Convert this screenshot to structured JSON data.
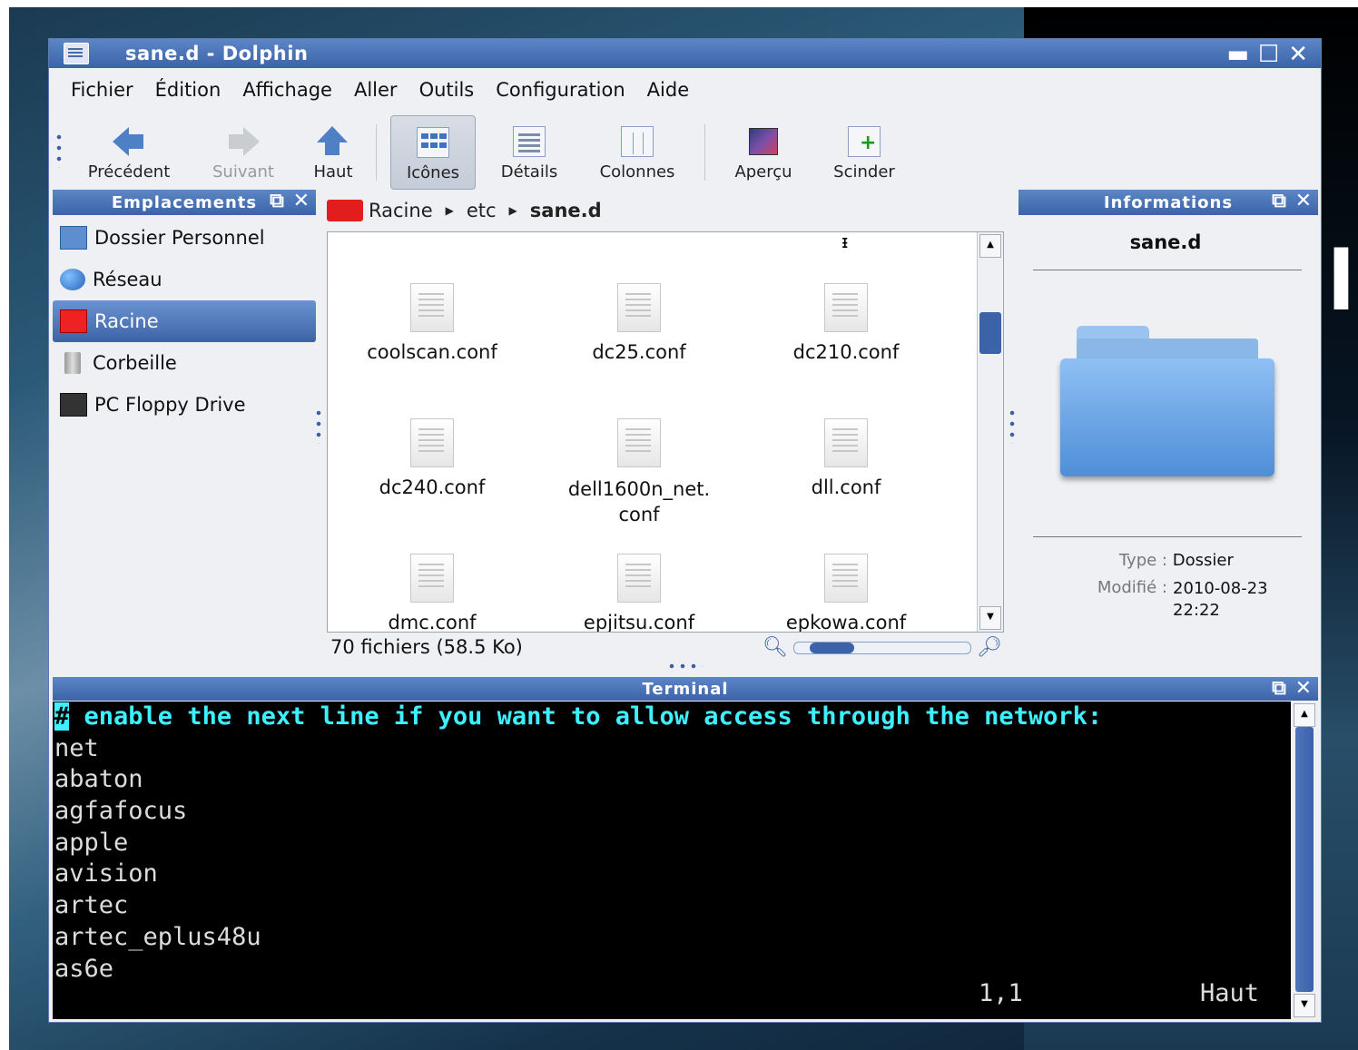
{
  "window": {
    "title": "sane.d - Dolphin"
  },
  "menu": [
    "Fichier",
    "Édition",
    "Affichage",
    "Aller",
    "Outils",
    "Configuration",
    "Aide"
  ],
  "toolbar": {
    "back": "Précédent",
    "forward": "Suivant",
    "up": "Haut",
    "icons": "Icônes",
    "details": "Détails",
    "columns": "Colonnes",
    "preview": "Aperçu",
    "split": "Scinder"
  },
  "places": {
    "title": "Emplacements",
    "items": [
      "Dossier Personnel",
      "Réseau",
      "Racine",
      "Corbeille",
      "PC Floppy Drive"
    ],
    "selected": "Racine"
  },
  "breadcrumb": [
    "Racine",
    "etc",
    "sane.d"
  ],
  "files": [
    "coolscan.conf",
    "dc25.conf",
    "dc210.conf",
    "dc240.conf",
    "dell1600n_net.\nconf",
    "dll.conf",
    "dmc.conf",
    "epjitsu.conf",
    "epkowa.conf"
  ],
  "status": {
    "text": "70 fichiers (58.5 Ko)",
    "zoom_level": 0.25
  },
  "info": {
    "title": "Informations",
    "name": "sane.d",
    "type_label": "Type :",
    "type_value": "Dossier",
    "modified_label": "Modifié :",
    "modified_value": "2010-08-23\n22:22"
  },
  "terminal": {
    "title": "Terminal",
    "lines": [
      "# enable the next line if you want to allow access through the network:",
      "net",
      "abaton",
      "agfafocus",
      "apple",
      "avision",
      "artec",
      "artec_eplus48u",
      "as6e"
    ],
    "position": "1,1",
    "scroll_label": "Haut"
  }
}
